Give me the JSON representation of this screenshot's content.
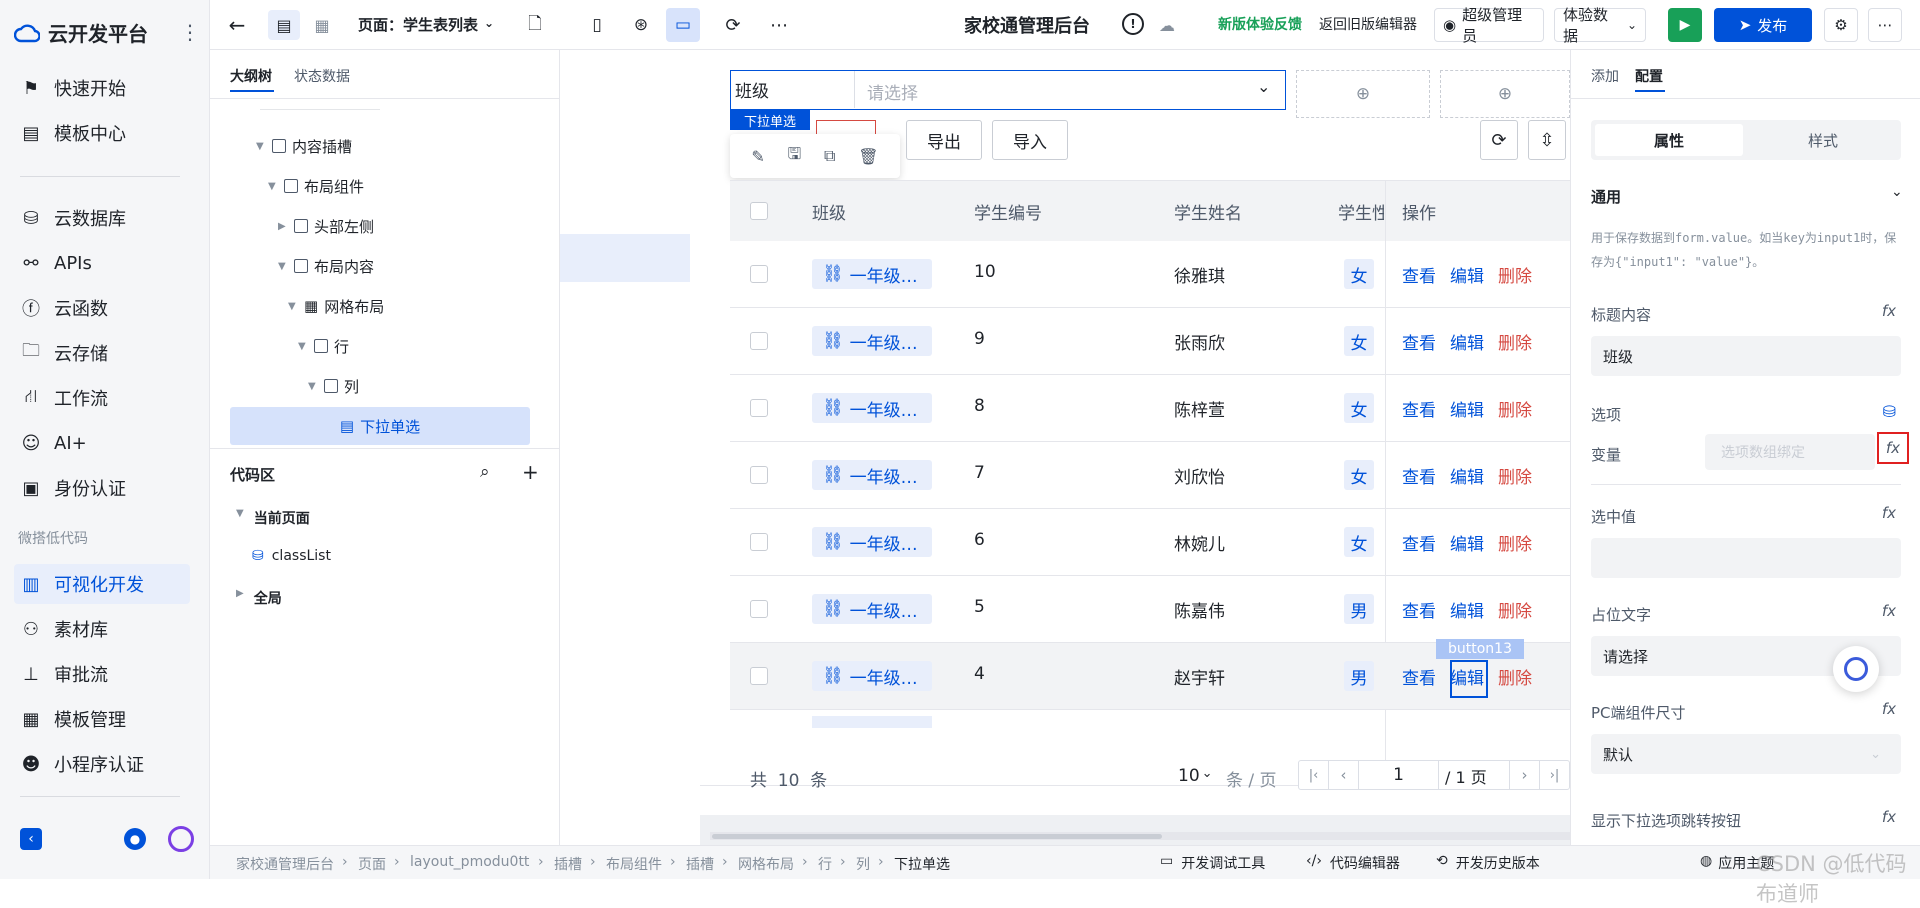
{
  "app": {
    "logo_text": "云开发平台",
    "nav": {
      "items": [
        {
          "label": "快速开始",
          "icon": "flag-icon"
        },
        {
          "label": "模板中心",
          "icon": "template-icon"
        },
        {
          "label": "云数据库",
          "icon": "database-icon"
        },
        {
          "label": "APIs",
          "icon": "api-icon"
        },
        {
          "label": "云函数",
          "icon": "function-icon"
        },
        {
          "label": "云存储",
          "icon": "folder-icon"
        },
        {
          "label": "工作流",
          "icon": "workflow-icon"
        },
        {
          "label": "AI+",
          "icon": "robot-icon"
        },
        {
          "label": "身份认证",
          "icon": "id-card-icon"
        }
      ],
      "section_label": "微搭低代码",
      "lowcode_items": [
        {
          "label": "可视化开发",
          "icon": "layout-icon",
          "active": true
        },
        {
          "label": "素材库",
          "icon": "assets-icon"
        },
        {
          "label": "审批流",
          "icon": "stamp-icon"
        },
        {
          "label": "模板管理",
          "icon": "template-manage-icon"
        },
        {
          "label": "小程序认证",
          "icon": "miniprogram-icon"
        }
      ]
    }
  },
  "topbar": {
    "page_label": "页面：学生表列表",
    "title": "家校通管理后台",
    "feedback": "新版体验反馈",
    "return_old": "返回旧版编辑器",
    "admin": "超级管理员",
    "experience_data": "体验数据",
    "publish": "发布",
    "accent": "#0052d9",
    "run_color": "#18a058"
  },
  "outline": {
    "tabs": [
      "大纲树",
      "状态数据"
    ],
    "tree": [
      {
        "label": "内容插槽",
        "level": 1
      },
      {
        "label": "布局组件",
        "level": 2
      },
      {
        "label": "头部左侧",
        "level": 3
      },
      {
        "label": "布局内容",
        "level": 3
      },
      {
        "label": "网格布局",
        "level": 4
      },
      {
        "label": "行",
        "level": 5
      },
      {
        "label": "列",
        "level": 6
      },
      {
        "label": "下拉单选",
        "level": 7,
        "selected": true
      }
    ],
    "code_area": {
      "title": "代码区",
      "current_page": "当前页面",
      "class_list": "classList",
      "global": "全局"
    }
  },
  "canvas": {
    "select_label": "班级",
    "select_placeholder": "请选择",
    "selected_tag": "下拉单选",
    "buttons": {
      "export": "导出",
      "import": "导入"
    },
    "table": {
      "headers": [
        "班级",
        "学生编号",
        "学生姓名",
        "学生性",
        "操作"
      ],
      "rows": [
        {
          "class": "一年级…",
          "id": "10",
          "name": "徐雅琪",
          "sex": "女"
        },
        {
          "class": "一年级…",
          "id": "9",
          "name": "张雨欣",
          "sex": "女"
        },
        {
          "class": "一年级…",
          "id": "8",
          "name": "陈梓萱",
          "sex": "女"
        },
        {
          "class": "一年级…",
          "id": "7",
          "name": "刘欣怡",
          "sex": "女"
        },
        {
          "class": "一年级…",
          "id": "6",
          "name": "林婉儿",
          "sex": "女"
        },
        {
          "class": "一年级…",
          "id": "5",
          "name": "陈嘉伟",
          "sex": "男"
        },
        {
          "class": "一年级…",
          "id": "4",
          "name": "赵宇轩",
          "sex": "男"
        }
      ],
      "actions": {
        "view": "查看",
        "edit": "编辑",
        "delete": "删除"
      },
      "hover_tag": "button13",
      "delete_color": "#d54941"
    },
    "pagination": {
      "total": "共  10  条",
      "page_size": "10",
      "per_page": "条 / 页",
      "current": "1",
      "pages": "/ 1 页"
    }
  },
  "panel": {
    "tabs": [
      "添加",
      "配置"
    ],
    "segment": [
      "属性",
      "样式"
    ],
    "section": "通用",
    "hint": "用于保存数据到form.value。如当key为input1时，保存为{\"input1\": \"value\"}。",
    "title_label": "标题内容",
    "title_value": "班级",
    "options_label": "选项",
    "variable_label": "变量",
    "variable_placeholder": "选项数组绑定",
    "selected_value_label": "选中值",
    "placeholder_label": "占位文字",
    "placeholder_value": "请选择",
    "pc_size_label": "PC端组件尺寸",
    "pc_size_value": "默认",
    "jump_btn_label": "显示下拉选项跳转按钮",
    "fx": "fx"
  },
  "statusbar": {
    "crumbs": [
      "家校通管理后台",
      "页面",
      "layout_pmodu0tt",
      "插槽",
      "布局组件",
      "插槽",
      "网格布局",
      "行",
      "列",
      "下拉单选"
    ],
    "dev_tools": "开发调试工具",
    "code_editor": "代码编辑器",
    "history": "开发历史版本",
    "theme": "应用主题",
    "watermark": "CSDN @低代码布道师"
  }
}
